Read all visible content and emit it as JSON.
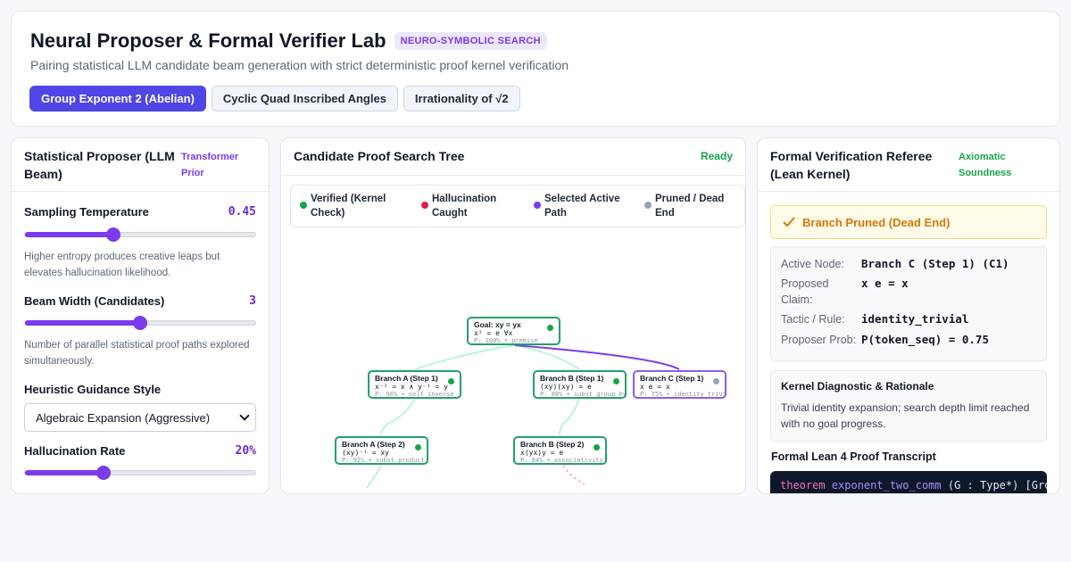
{
  "header": {
    "title": "Neural Proposer & Formal Verifier Lab",
    "badge": "NEURO-SYMBOLIC SEARCH",
    "subtitle": "Pairing statistical LLM candidate beam generation with strict deterministic proof kernel verification",
    "tabs": [
      {
        "label": "Group Exponent 2 (Abelian)",
        "active": true
      },
      {
        "label": "Cyclic Quad Inscribed Angles",
        "active": false
      },
      {
        "label": "Irrationality of √2",
        "active": false
      }
    ]
  },
  "proposer": {
    "title": "Statistical Proposer (LLM Beam)",
    "tag": "Transformer Prior",
    "temperature": {
      "label": "Sampling Temperature",
      "value": "0.45",
      "fraction": 0.385,
      "help": "Higher entropy produces creative leaps but elevates hallucination likelihood."
    },
    "beam": {
      "label": "Beam Width (Candidates)",
      "value": "3",
      "fraction": 0.5,
      "help": "Number of parallel statistical proof paths explored simultaneously."
    },
    "heuristic": {
      "label": "Heuristic Guidance Style",
      "selected": "Algebraic Expansion (Aggressive)"
    },
    "hallucination": {
      "label": "Hallucination Rate",
      "value": "20%",
      "fraction": 0.34
    }
  },
  "tree": {
    "title": "Candidate Proof Search Tree",
    "status": "Ready",
    "legend": [
      {
        "label": "Verified (Kernel Check)",
        "color": "#16a34a"
      },
      {
        "label": "Hallucination Caught",
        "color": "#e11d48"
      },
      {
        "label": "Selected Active Path",
        "color": "#7c3aed"
      },
      {
        "label": "Pruned / Dead End",
        "color": "#94a3b8"
      }
    ],
    "nodes": {
      "root": {
        "title": "Goal: xy = yx",
        "claim": "x² = e ∀x",
        "prob": "P: 100% • premise"
      },
      "a1": {
        "title": "Branch A (Step 1)",
        "claim": "x⁻¹ = x ∧ y⁻¹ = y",
        "prob": "P: 96% • self_inverse"
      },
      "b1": {
        "title": "Branch B (Step 1)",
        "claim": "(xy)(xy) = e",
        "prob": "P: 88% • subst_group_hyp"
      },
      "c1": {
        "title": "Branch C (Step 1)",
        "claim": "x e = x",
        "prob": "P: 75% • identity_trivial"
      },
      "a2": {
        "title": "Branch A (Step 2)",
        "claim": "(xy)⁻¹ = xy",
        "prob": "P: 92% • subst_product"
      },
      "b2": {
        "title": "Branch B (Step 2)",
        "claim": "x(yx)y = e",
        "prob": "P: 84% • associativity"
      }
    }
  },
  "referee": {
    "title": "Formal Verification Referee (Lean Kernel)",
    "tag": "Axiomatic Soundness",
    "alert": "Branch Pruned (Dead End)",
    "fields": [
      {
        "key": "Active Node:",
        "value": "Branch C (Step 1) (C1)"
      },
      {
        "key": "Proposed Claim:",
        "value": "x e = x"
      },
      {
        "key": "Tactic / Rule:",
        "value": "identity_trivial"
      },
      {
        "key": "Proposer Prob:",
        "value": "P(token_seq) = 0.75"
      }
    ],
    "diagnostic_title": "Kernel Diagnostic & Rationale",
    "diagnostic_text": "Trivial identity expansion; search depth limit reached with no goal progress.",
    "transcript_title": "Formal Lean 4 Proof Transcript",
    "code_kw": "theorem",
    "code_fn": "exponent_two_comm",
    "code_rest": " (G : Type*) [Group G]"
  },
  "colors": {
    "accent": "#4f46e5",
    "verified": "#16a34a",
    "selected": "#7c3aed",
    "pruned": "#94a3b8",
    "warning": "#d97706"
  }
}
